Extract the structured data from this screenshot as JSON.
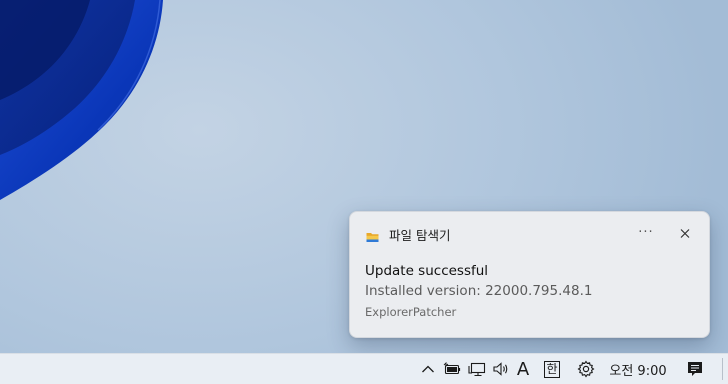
{
  "toast": {
    "app_name": "파일 탐색기",
    "more_label": "···",
    "title": "Update successful",
    "body": "Installed version: 22000.795.48.1",
    "attribution": "ExplorerPatcher"
  },
  "taskbar": {
    "input_indicator": "A",
    "ime_mode": "한",
    "clock": "오전 9:00",
    "icons": [
      "chevron-up-icon",
      "battery-icon",
      "network-icon",
      "speaker-icon",
      "gear-icon",
      "notification-icon"
    ]
  },
  "colors": {
    "wallpaper": "#b4c9df",
    "bloom_blue": "#0a3fc4",
    "toast_bg": "#ebedf0",
    "taskbar_bg": "#e9eef4"
  }
}
